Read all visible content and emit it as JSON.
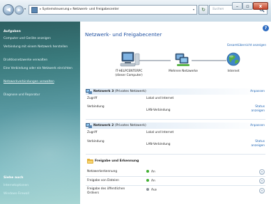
{
  "window": {
    "minimize_icon": "minimize-icon",
    "maximize_icon": "maximize-icon",
    "close_icon": "close-icon",
    "minimize_glyph": "–",
    "maximize_glyph": "▫",
    "close_glyph": "x"
  },
  "toolbar": {
    "back_glyph": "◀",
    "forward_glyph": "▶",
    "recent_glyph": "▾",
    "address_parts": [
      "Systemsteuerung",
      "Netzwerk- und Freigabecenter"
    ],
    "address_separator": "▸",
    "address_dropdown_glyph": "▾",
    "refresh_glyph": "↻",
    "search_placeholder": "Suchen"
  },
  "sidebar": {
    "tasks_heading": "Aufgaben",
    "tasks": [
      "Computer und Geräte anzeigen",
      "Verbindung mit einem Netzwerk herstellen",
      "Drahtlosnetzwerke verwalten",
      "Eine Verbindung oder ein Netzwerk einrichten",
      "Netzwerkverbindungen verwalten",
      "Diagnose und Reparatur"
    ],
    "see_also_heading": "Siehe auch",
    "see_also": [
      "Internetoptionen",
      "Windows-Firewall"
    ]
  },
  "main": {
    "help_glyph": "?",
    "title": "Netzwerk- und Freigabecenter",
    "full_map_link": "Gesamtübersicht anzeigen",
    "map": {
      "computer_name": "IT-HELPCENTERPC",
      "computer_sub": "(dieser Computer)",
      "networks_label": "Mehrere Netzwerke",
      "internet_label": "Internet"
    },
    "networks": [
      {
        "name": "Netzwerk 3",
        "type": "(Privates Netzwerk)",
        "adjust": "Anpassen",
        "access_label": "Zugriff",
        "access_value": "Lokal und Internet",
        "connection_label": "Verbindung",
        "connection_value": "LAN-Verbindung",
        "status_link": "Status anzeigen"
      },
      {
        "name": "Netzwerk 2",
        "type": "(Privates Netzwerk)",
        "adjust": "Anpassen",
        "access_label": "Zugriff",
        "access_value": "Lokal und Internet",
        "connection_label": "Verbindung",
        "connection_value": "LAN-Verbindung",
        "status_link": "Status anzeigen"
      }
    ],
    "sharing": {
      "title": "Freigabe und Erkennung",
      "expand_glyph": "⌄",
      "items": [
        {
          "label": "Netzwerkerkennung",
          "status": "An",
          "status_color": "#3fae2f"
        },
        {
          "label": "Freigabe von Dateien",
          "status": "An",
          "status_color": "#3fae2f"
        },
        {
          "label": "Freigabe des öffentlichen Ordners",
          "status": "Aus",
          "status_color": "#8a9198"
        }
      ]
    }
  }
}
